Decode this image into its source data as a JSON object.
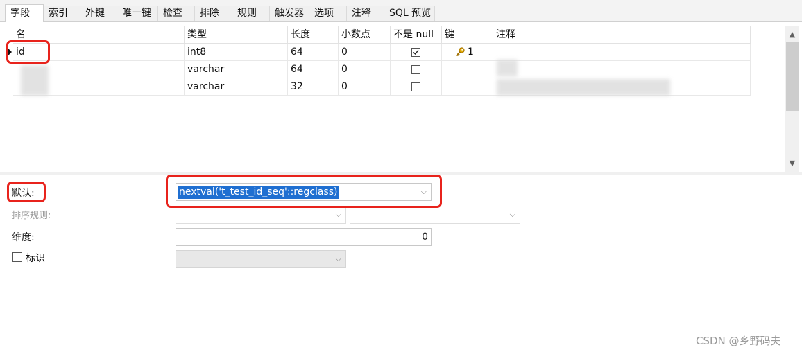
{
  "tabs": [
    "字段",
    "索引",
    "外键",
    "唯一键",
    "检查",
    "排除",
    "规则",
    "触发器",
    "选项",
    "注释",
    "SQL 预览"
  ],
  "grid": {
    "headers": [
      "名",
      "类型",
      "长度",
      "小数点",
      "不是 null",
      "键",
      "注释"
    ],
    "rows": [
      {
        "name": "id",
        "type": "int8",
        "length": "64",
        "decimals": "0",
        "not_null": true,
        "key": "1",
        "comment": ""
      },
      {
        "name": "",
        "type": "varchar",
        "length": "64",
        "decimals": "0",
        "not_null": false,
        "key": "",
        "comment": ""
      },
      {
        "name": "",
        "type": "varchar",
        "length": "32",
        "decimals": "0",
        "not_null": false,
        "key": "",
        "comment": ""
      }
    ]
  },
  "props": {
    "default_label": "默认:",
    "default_value": "nextval('t_test_id_seq'::regclass)",
    "collation_label": "排序规则:",
    "dimension_label": "维度:",
    "dimension_value": "0",
    "identity_label": "标识"
  },
  "watermark": "CSDN @乡野码夫",
  "colors": {
    "highlight": "#1f6fd1",
    "annotation": "#e8231c",
    "key_icon": "#e0a800"
  }
}
